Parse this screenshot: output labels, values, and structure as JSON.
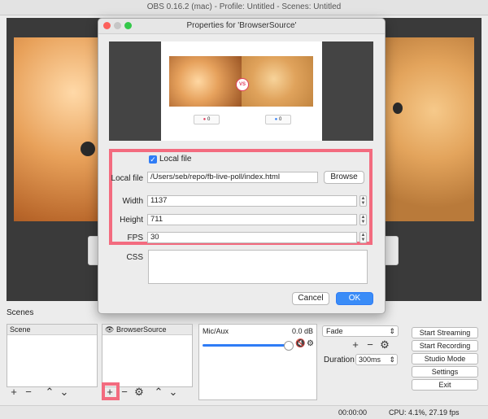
{
  "window_title": "OBS 0.16.2 (mac) - Profile: Untitled - Scenes: Untitled",
  "dialog": {
    "title": "Properties for 'BrowserSource'",
    "preview_votes": [
      "0",
      "0"
    ],
    "preview_vs": "VS",
    "local_file_checkbox_label": "Local file",
    "local_file_label": "Local file",
    "local_file_value": "/Users/seb/repo/fb-live-poll/index.html",
    "browse_label": "Browse",
    "width_label": "Width",
    "width_value": "1137",
    "height_label": "Height",
    "height_value": "711",
    "fps_label": "FPS",
    "fps_value": "30",
    "css_label": "CSS",
    "cancel_label": "Cancel",
    "ok_label": "OK"
  },
  "scenes_label": "Scenes",
  "scenes_list": [
    "Scene"
  ],
  "sources_list": [
    "BrowserSource"
  ],
  "mixer": {
    "name": "Mic/Aux",
    "level": "0.0 dB"
  },
  "transition": {
    "selected": "Fade",
    "duration_label": "Duration",
    "duration_value": "300ms"
  },
  "controls": [
    "Start Streaming",
    "Start Recording",
    "Studio Mode",
    "Settings",
    "Exit"
  ],
  "status": {
    "time": "00:00:00",
    "cpu": "CPU: 4.1%, 27.19 fps"
  },
  "colors": {
    "highlight": "#f36b7f",
    "accent": "#2f7cf6"
  }
}
